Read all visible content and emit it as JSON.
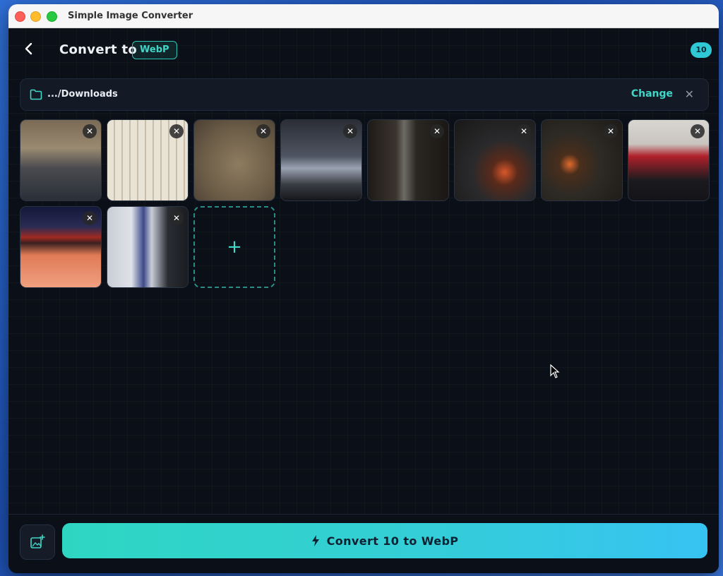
{
  "window": {
    "title": "Simple Image Converter"
  },
  "header": {
    "title": "Convert to",
    "format": "WebP",
    "count": "10"
  },
  "folder": {
    "path": ".../Downloads",
    "change_label": "Change",
    "close_label": "✕"
  },
  "images": [
    {
      "remove_label": "✕",
      "scene": "station-waiting-room"
    },
    {
      "remove_label": "✕",
      "scene": "timetable-board"
    },
    {
      "remove_label": "✕",
      "scene": "ticket-in-hand"
    },
    {
      "remove_label": "✕",
      "scene": "cloudy-sky"
    },
    {
      "remove_label": "✕",
      "scene": "dark-interior"
    },
    {
      "remove_label": "✕",
      "scene": "stove-grill"
    },
    {
      "remove_label": "✕",
      "scene": "train-interior-fire"
    },
    {
      "remove_label": "✕",
      "scene": "santa-costumes"
    },
    {
      "remove_label": "✕",
      "scene": "snowy-station-night"
    },
    {
      "remove_label": "✕",
      "scene": "train-platform"
    }
  ],
  "add_tile": {
    "label": "+"
  },
  "footer": {
    "convert_label": "Convert 10 to WebP"
  },
  "colors": {
    "accent": "#2ec6b6",
    "background": "#0b0f17",
    "button_gradient_start": "#2ed6c2",
    "button_gradient_end": "#37c3f2"
  }
}
